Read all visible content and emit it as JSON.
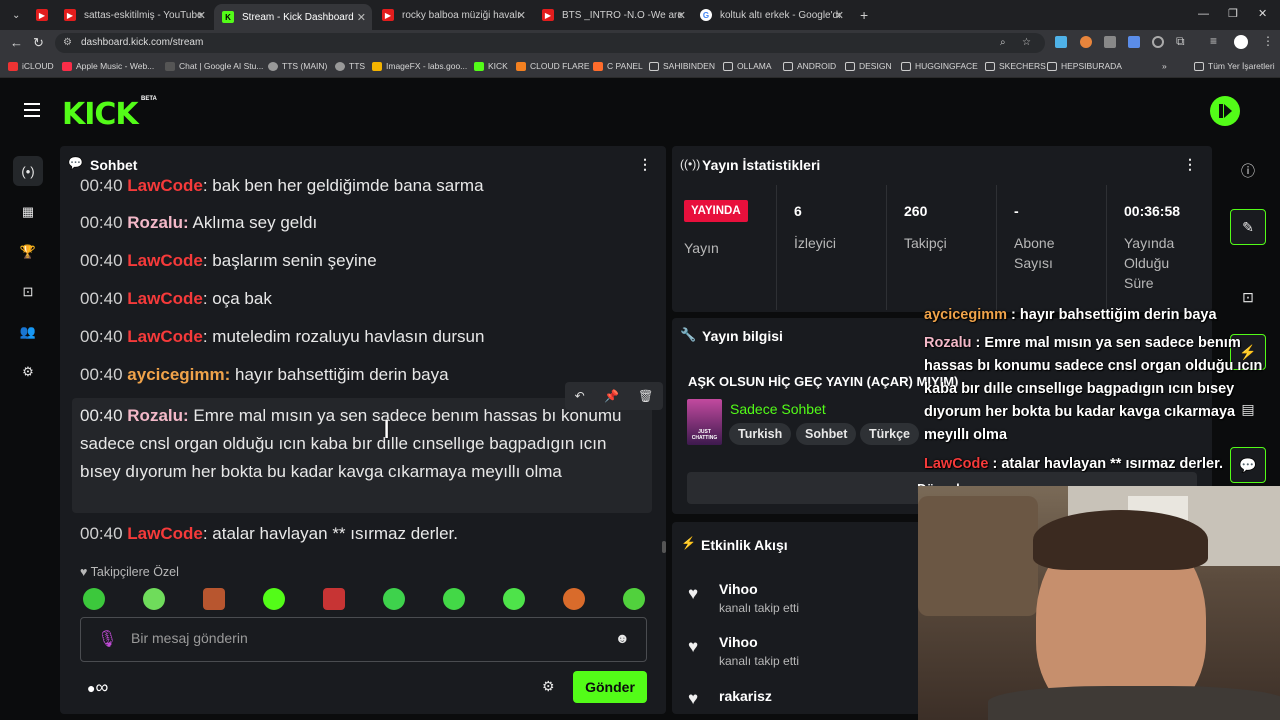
{
  "browser": {
    "tabs": [
      {
        "title": "sattas-eskitilmiş - YouTube",
        "icon": "youtube"
      },
      {
        "title": "Stream - Kick Dashboard",
        "icon": "kick",
        "active": true
      },
      {
        "title": "rocky balboa müziği havalı döv",
        "icon": "youtube"
      },
      {
        "title": "BTS _INTRO -N.O -We are bulle",
        "icon": "youtube"
      },
      {
        "title": "koltuk altı erkek - Google'da Ar",
        "icon": "google"
      }
    ],
    "url": "dashboard.kick.com/stream",
    "bookmarks": [
      "iCLOUD",
      "Apple Music - Web...",
      "Chat | Google AI Stu...",
      "TTS (MAIN)",
      "TTS",
      "ImageFX - labs.goo...",
      "KICK",
      "CLOUD FLARE",
      "C PANEL",
      "SAHIBINDEN",
      "OLLAMA",
      "ANDROID",
      "DESIGN",
      "HUGGINGFACE",
      "SKECHERS",
      "HEPSIBURADA"
    ],
    "all_bookmarks": "Tüm Yer İşaretleri"
  },
  "header": {
    "logo": "KICK",
    "beta": "BETA"
  },
  "chat": {
    "title": "Sohbet",
    "messages": [
      {
        "time": "00:40",
        "user": "LawCode",
        "text": "bak ben her geldiğimde bana sarma",
        "style": "law"
      },
      {
        "time": "00:40",
        "user": "Rozalu",
        "text": "Aklıma sey geldı",
        "style": "roz"
      },
      {
        "time": "00:40",
        "user": "LawCode",
        "text": "başlarım senin şeyine",
        "style": "law"
      },
      {
        "time": "00:40",
        "user": "LawCode",
        "text": "oça bak",
        "style": "law"
      },
      {
        "time": "00:40",
        "user": "LawCode",
        "text": "muteledim rozaluyu havlasın dursun",
        "style": "law"
      },
      {
        "time": "00:40",
        "user": "aycicegimm",
        "text": "hayır bahsettiğim derin baya",
        "style": "ayc"
      }
    ],
    "highlighted": {
      "time": "00:40",
      "user": "Rozalu",
      "text": "Emre mal mısın ya sen sadece benım hassas bı konumu sadece cnsl organ olduğu ıcın kaba bır dılle cınsellıge bagpadıgın ıcın bısey dıyorum her bokta bu kadar kavga cıkarmaya meyıllı olma"
    },
    "last": {
      "time": "00:40",
      "user": "LawCode",
      "text": "atalar havlayan ** ısırmaz derler."
    },
    "followers_only": "Takipçilere Özel",
    "input_placeholder": "Bir mesaj gönderin",
    "send": "Gönder",
    "infinity": "∞"
  },
  "stats": {
    "title": "Yayın İstatistikleri",
    "live_badge": "YAYINDA",
    "live_label": "Yayın",
    "viewers": "6",
    "viewers_label": "İzleyici",
    "followers": "260",
    "followers_label": "Takipçi",
    "subs": "-",
    "subs_label": "Abone Sayısı",
    "uptime": "00:36:58",
    "uptime_label": "Yayında Olduğu Süre"
  },
  "info": {
    "title": "Yayın bilgisi",
    "stream_title": "AŞK OLSUN HİÇ GEÇ YAYIN (AÇAR) MIYIM)",
    "category": "Sadece Sohbet",
    "thumb_text": "JUST CHATTING",
    "tags": [
      "Turkish",
      "Sohbet",
      "Türkçe"
    ],
    "edit": "Düzenle"
  },
  "activity": {
    "title": "Etkinlik Akışı",
    "items": [
      {
        "name": "Vihoo",
        "action": "kanalı takip etti"
      },
      {
        "name": "Vihoo",
        "action": "kanalı takip etti"
      },
      {
        "name": "rakarisz",
        "action": ""
      }
    ]
  },
  "overlay": {
    "lines": [
      {
        "user": "aycicegimm",
        "text": " : hayır bahsettiğim derin baya"
      },
      {
        "user": "Rozalu",
        "text": " : Emre mal mısın ya sen sadece benım hassas bı konumu sadece cnsl organ olduğu ıcın kaba bır dılle cınsellıge bagpadıgın ıcın bısey dıyorum her bokta bu kadar kavga cıkarmaya meyıllı olma"
      },
      {
        "user": "LawCode",
        "text": " : atalar havlayan ** ısırmaz derler."
      }
    ]
  },
  "colors": {
    "kick_green": "#53fc18",
    "lawcode": "#f53a3a",
    "rozalu": "#f3b8c8",
    "aycicegimm": "#f0a34a"
  }
}
